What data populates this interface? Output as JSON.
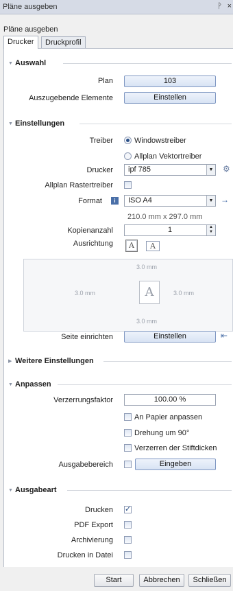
{
  "window": {
    "title": "Pläne ausgeben",
    "pin_glyph": "ᚹ",
    "close_glyph": "×"
  },
  "panel": {
    "title": "Pläne ausgeben"
  },
  "tabs": [
    {
      "label": "Drucker"
    },
    {
      "label": "Druckprofil"
    }
  ],
  "auswahl": {
    "heading": "Auswahl",
    "plan_label": "Plan",
    "plan_value": "103",
    "elements_label": "Auszugebende Elemente",
    "elements_button": "Einstellen"
  },
  "einstellungen": {
    "heading": "Einstellungen",
    "treiber_label": "Treiber",
    "treiber_options": [
      "Windowstreiber",
      "Allplan Vektortreiber"
    ],
    "drucker_label": "Drucker",
    "drucker_value": "ipf 785",
    "raster_label": "Allplan Rastertreiber",
    "format_label": "Format",
    "format_value": "ISO A4",
    "format_size": "210.0 mm x 297.0 mm",
    "kopien_label": "Kopienanzahl",
    "kopien_value": "1",
    "ausrichtung_label": "Ausrichtung",
    "orient_glyph": "A",
    "preview": {
      "top": "3.0 mm",
      "left": "3.0 mm",
      "right": "3.0 mm",
      "bottom": "3.0 mm",
      "glyph": "A"
    },
    "seite_label": "Seite einrichten",
    "seite_button": "Einstellen"
  },
  "weitere": {
    "heading": "Weitere Einstellungen"
  },
  "anpassen": {
    "heading": "Anpassen",
    "verzerrung_label": "Verzerrungsfaktor",
    "verzerrung_value": "100.00 %",
    "options": [
      "An Papier anpassen",
      "Drehung um 90°",
      "Verzerren der Stiftdicken"
    ],
    "bereich_label": "Ausgabebereich",
    "bereich_button": "Eingeben"
  },
  "ausgabeart": {
    "heading": "Ausgabeart",
    "items": [
      {
        "label": "Drucken",
        "checked": true
      },
      {
        "label": "PDF Export",
        "checked": false
      },
      {
        "label": "Archivierung",
        "checked": false
      },
      {
        "label": "Drucken in Datei",
        "checked": false
      }
    ]
  },
  "footer": {
    "start": "Start",
    "abbrechen": "Abbrechen",
    "schliessen": "Schließen"
  },
  "icons": {
    "collapse": "▼",
    "expand": "▶",
    "dropdown": "▼",
    "spin_up": "▲",
    "spin_down": "▼",
    "gear": "⚙",
    "info": "i",
    "arrow_right": "→",
    "arrow_left": "⇤",
    "check": "✓"
  },
  "colors": {
    "accent": "#2a4f86",
    "button_border": "#7f97c2"
  }
}
